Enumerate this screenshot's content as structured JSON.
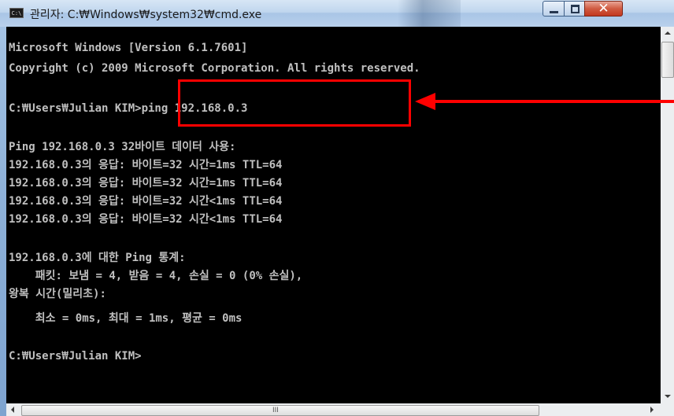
{
  "window": {
    "title": "관리자: C:₩Windows₩system32₩cmd.exe",
    "icon_text": "C:\\",
    "controls": {
      "minimize": "minimize-icon",
      "maximize": "maximize-icon",
      "close": "✕"
    }
  },
  "console": {
    "lines": [
      "Microsoft Windows [Version 6.1.7601]",
      "Copyright (c) 2009 Microsoft Corporation. All rights reserved.",
      "",
      "C:₩Users₩Julian KIM>ping 192.168.0.3",
      "",
      "Ping 192.168.0.3 32바이트 데이터 사용:",
      "192.168.0.3의 응답: 바이트=32 시간=1ms TTL=64",
      "192.168.0.3의 응답: 바이트=32 시간=1ms TTL=64",
      "192.168.0.3의 응답: 바이트=32 시간<1ms TTL=64",
      "192.168.0.3의 응답: 바이트=32 시간<1ms TTL=64",
      "",
      "192.168.0.3에 대한 Ping 통계:",
      "    패킷: 보냄 = 4, 받음 = 4, 손실 = 0 (0% 손실),",
      "왕복 시간(밀리초):",
      "    최소 = 0ms, 최대 = 1ms, 평균 = 0ms",
      "",
      "C:₩Users₩Julian KIM>"
    ],
    "text_color": "#c0c0c0",
    "background": "#000000"
  },
  "annotation": {
    "color": "#ff0000",
    "highlighted_command": "ping 192.168.0.3"
  },
  "scrollbars": {
    "horizontal_grip": "III"
  }
}
